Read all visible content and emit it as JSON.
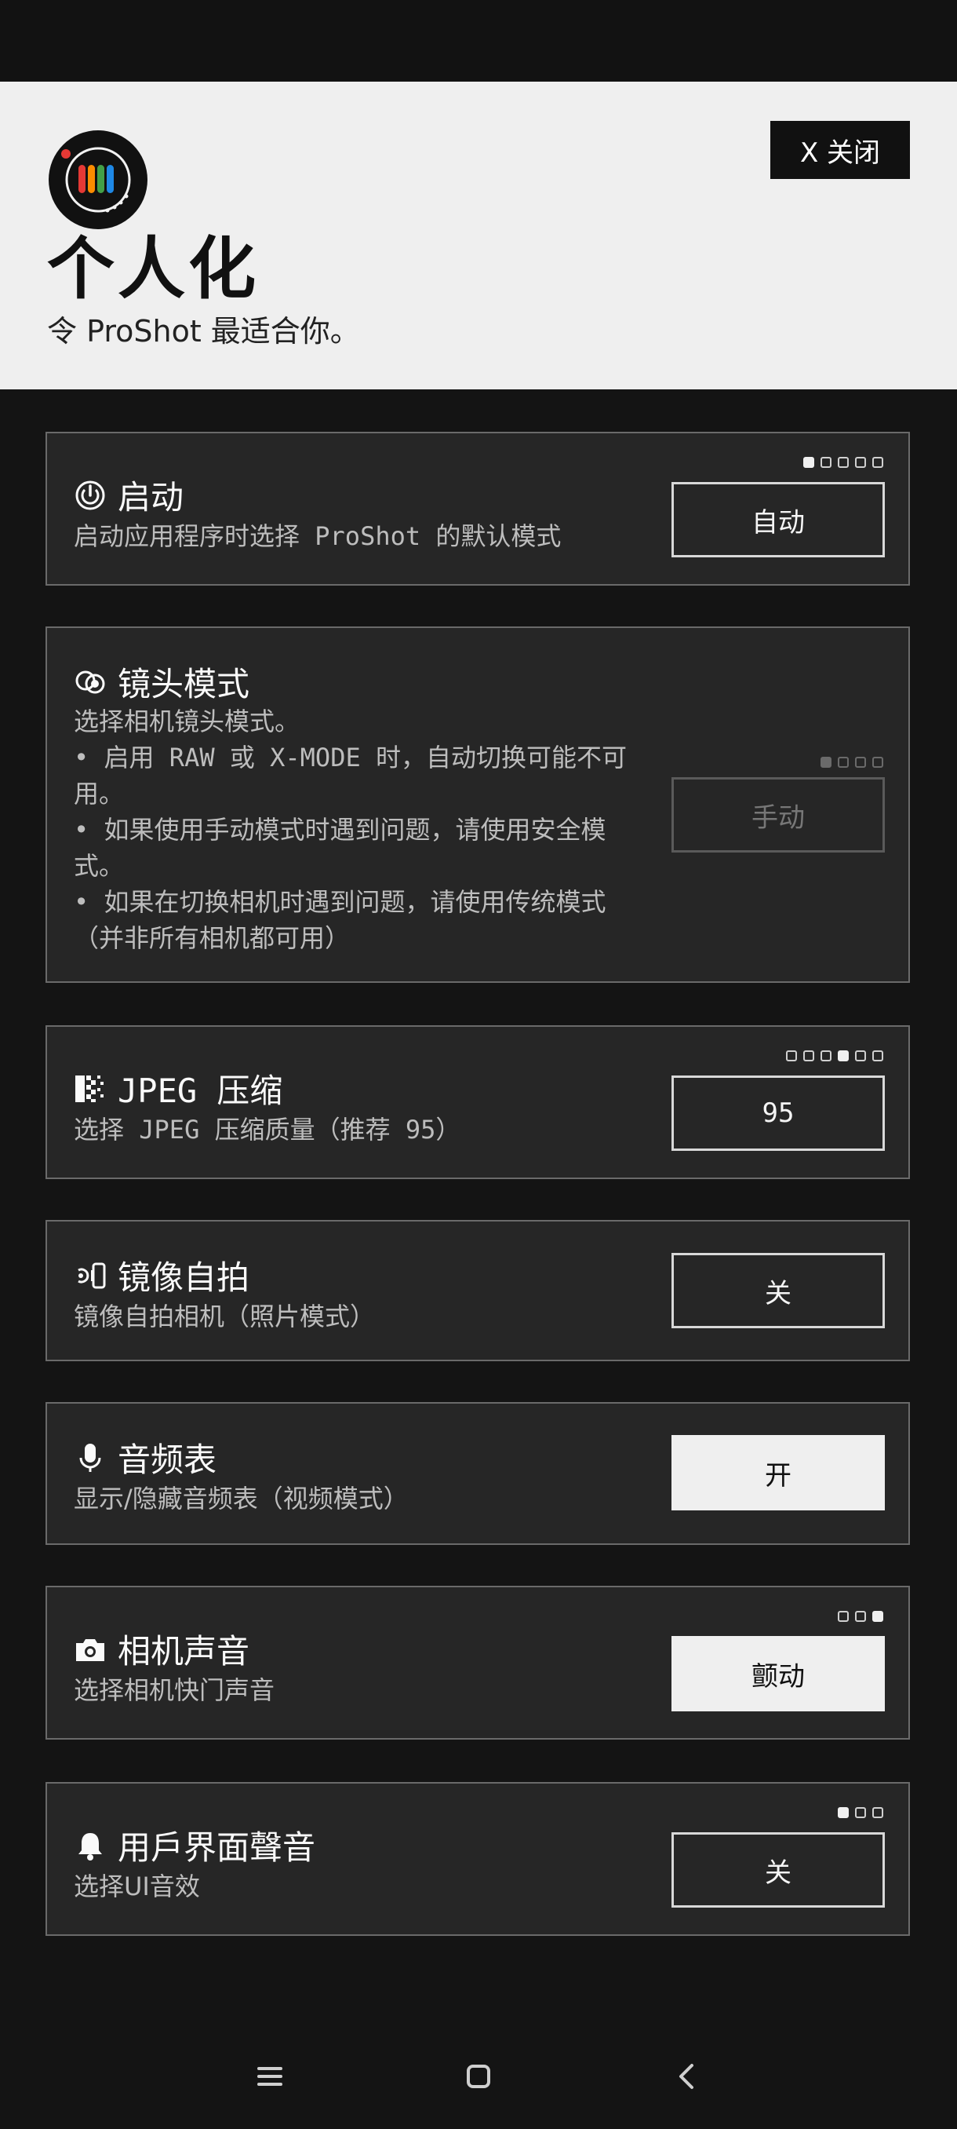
{
  "header": {
    "title": "个人化",
    "subtitle": "令 ProShot 最适合你。",
    "close_label": "X 关闭"
  },
  "settings": [
    {
      "icon": "power-icon",
      "title": "启动",
      "description": "启动应用程序时选择 ProShot 的默认模式",
      "value": "自动",
      "dots": {
        "count": 5,
        "active": 0
      },
      "state": "outline"
    },
    {
      "icon": "camera-lens-icon",
      "title": "镜头模式",
      "description_lines": [
        "选择相机镜头模式。",
        "• 启用 RAW 或 X-MODE 时，自动切换可能不可用。",
        "• 如果使用手动模式时遇到问题，请使用安全模式。",
        "• 如果在切换相机时遇到问题，请使用传统模式（并非所有相机都可用）"
      ],
      "value": "手动",
      "dots": {
        "count": 4,
        "active": 0
      },
      "state": "disabled"
    },
    {
      "icon": "jpeg-compression-icon",
      "title": "JPEG 压缩",
      "description": "选择 JPEG 压缩质量（推荐 95）",
      "value": "95",
      "dots": {
        "count": 6,
        "active": 3
      },
      "state": "outline"
    },
    {
      "icon": "mirror-selfie-icon",
      "title": "镜像自拍",
      "description": "镜像自拍相机（照片模式）",
      "value": "关",
      "state": "outline"
    },
    {
      "icon": "microphone-icon",
      "title": "音频表",
      "description": "显示/隐藏音频表（视频模式）",
      "value": "开",
      "state": "filled"
    },
    {
      "icon": "camera-icon",
      "title": "相机声音",
      "description": "选择相机快门声音",
      "value": "颤动",
      "dots": {
        "count": 3,
        "active": 2
      },
      "state": "filled"
    },
    {
      "icon": "bell-icon",
      "title": "用戶界面聲音",
      "description": "选择UI音效",
      "value": "关",
      "dots": {
        "count": 3,
        "active": 0
      },
      "state": "outline"
    }
  ],
  "navbar": {
    "menu": "menu-icon",
    "home": "home-icon",
    "back": "back-icon"
  }
}
